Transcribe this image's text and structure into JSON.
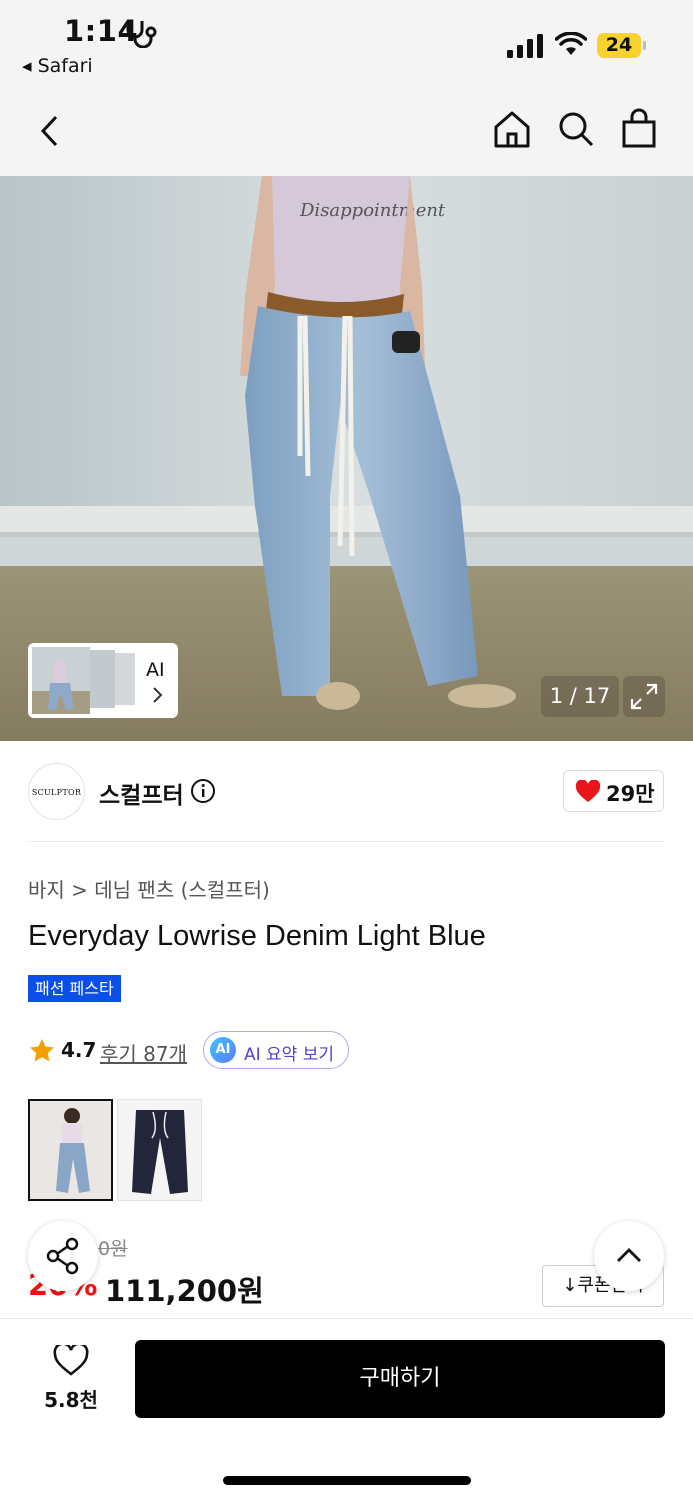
{
  "status_bar": {
    "time": "1:14",
    "back_app": "◂ Safari",
    "battery": "24"
  },
  "nav": {
    "icons": [
      "back-icon",
      "home-icon",
      "search-icon",
      "shopping-bag-icon"
    ]
  },
  "gallery": {
    "ai_label": "AI",
    "counter": "1 / 17"
  },
  "brand": {
    "logo_text": "SCULPTOR",
    "name": "스컬프터",
    "likes": "29만"
  },
  "product": {
    "breadcrumb": "바지 > 데님 팬츠 (스컬프터)",
    "title": "Everyday Lowrise Denim Light Blue",
    "badge": "패션 페스타",
    "rating": "4.7",
    "reviews": "후기 87개",
    "ai_summary_badge": "AI",
    "ai_summary": "AI 요약 보기",
    "original_price": "0원",
    "discount": "20%",
    "price": "111,200원",
    "coupon": "↓쿠폰받기"
  },
  "bottom": {
    "wish_count": "5.8천",
    "buy_label": "구매하기"
  },
  "colors": {
    "accent_blue": "#0a4fe8",
    "discount_red": "#f31110",
    "battery_yellow": "#f6d32d"
  }
}
